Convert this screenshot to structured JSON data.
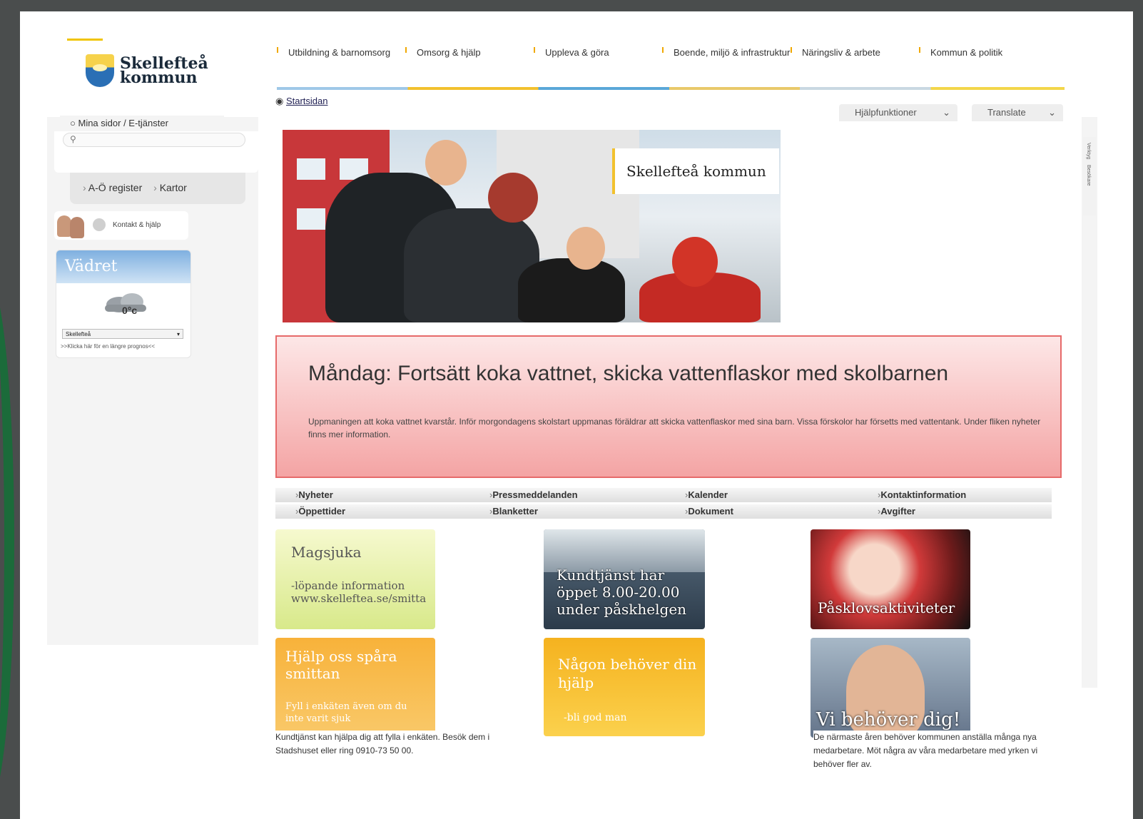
{
  "header": {
    "logo_line1": "Skellefteå",
    "logo_line2": "kommun",
    "nav": [
      "Utbildning & barnomsorg",
      "Omsorg & hjälp",
      "Uppleva & göra",
      "Boende, miljö & infrastruktur",
      "Näringsliv & arbete",
      "Kommun & politik"
    ]
  },
  "breadcrumb": {
    "link": "Startsidan"
  },
  "toolbar": {
    "help_label": "Hjälpfunktioner",
    "translate_label": "Translate"
  },
  "sidebar": {
    "mina_sidor": "Mina sidor / E-tjänster",
    "ao_register": "A-Ö register",
    "kartor": "Kartor",
    "contact_label": "Kontakt & hjälp",
    "weather": {
      "title": "Vädret",
      "temperature": "0°c",
      "city": "Skellefteå",
      "link": ">>Klicka här för en längre prognos<<"
    }
  },
  "hero": {
    "label": "Skellefteå kommun"
  },
  "side_tabs": [
    "Verktyg",
    "Besökare"
  ],
  "alert": {
    "title": "Måndag: Fortsätt koka vattnet, skicka vattenflaskor med skolbarnen",
    "text": "Uppmaningen att koka vattnet kvarstår. Inför morgondagens skolstart uppmanas föräldrar att skicka vattenflaskor med sina barn. Vissa förskolor har försetts med vattentank. Under fliken nyheter finns mer information."
  },
  "quicknav": {
    "row1": [
      "Nyheter",
      "Pressmeddelanden",
      "Kalender",
      "Kontaktinformation"
    ],
    "row2": [
      "Öppettider",
      "Blanketter",
      "Dokument",
      "Avgifter"
    ]
  },
  "tiles": {
    "magsjuka_title": "Magsjuka",
    "magsjuka_text": "-löpande information www.skelleftea.se/smitta",
    "kundtjanst": "Kundtjänst har öppet 8.00-20.00 under påskhelgen",
    "pask": "Påsklovsaktiviteter",
    "hjalp_title": "Hjälp oss spåra smittan",
    "hjalp_text": "Fyll i enkäten även om du inte varit sjuk",
    "hjalp_caption": "Kundtjänst kan hjälpa dig att fylla i enkäten. Besök dem i Stadshuset eller ring 0910-73 50 00.",
    "nagon_title": "Någon behöver din hjälp",
    "nagon_text": "-bli god man",
    "vi_title": "Vi behöver dig!",
    "vi_caption": "De närmaste åren behöver kommunen anställa många nya medarbetare. Möt några av våra medarbetare med yrken vi behöver fler av."
  },
  "colors": {
    "alert_border": "#e66a6a",
    "accent_yellow": "#f2c12e",
    "dark_frame": "#4a4d4d",
    "green_arc": "#1b6b3a"
  }
}
